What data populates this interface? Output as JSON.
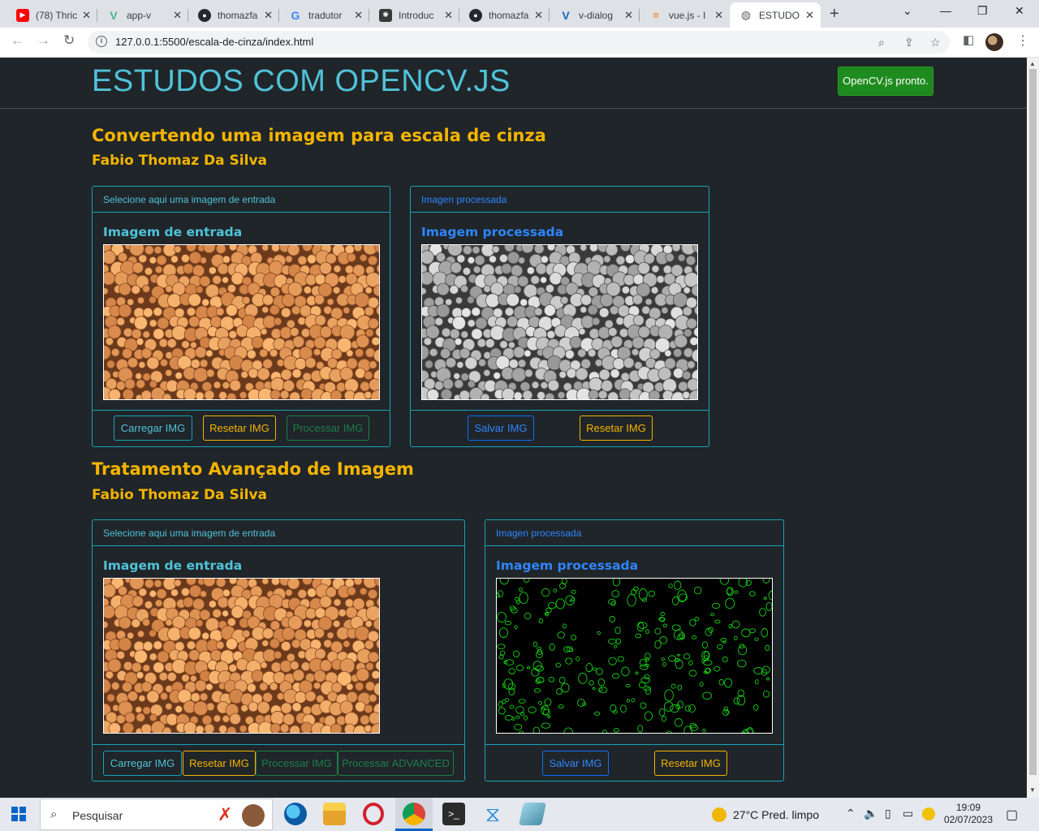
{
  "browser": {
    "tabs": [
      {
        "title": "(78) Thric",
        "favicon": "youtube-icon",
        "color": "#ff0000"
      },
      {
        "title": "app-v",
        "favicon": "vue-icon",
        "color": "#41b883"
      },
      {
        "title": "thomazfa",
        "favicon": "github-icon",
        "color": "#24292f"
      },
      {
        "title": "tradutor",
        "favicon": "google-icon",
        "color": "#4285f4"
      },
      {
        "title": "Introduc",
        "favicon": "openai-icon",
        "color": "#3a3a3a"
      },
      {
        "title": "thomazfa",
        "favicon": "github-icon",
        "color": "#24292f"
      },
      {
        "title": "v-dialog",
        "favicon": "vuetify-icon",
        "color": "#1867c0"
      },
      {
        "title": "vue.js - I",
        "favicon": "stackoverflow-icon",
        "color": "#f48024"
      },
      {
        "title": "ESTUDO",
        "favicon": "globe-icon",
        "color": "#5f6368"
      }
    ],
    "url": "127.0.0.1:5500/escala-de-cinza/index.html"
  },
  "page": {
    "brand": "ESTUDOS COM OPENCV.JS",
    "status": "OpenCV.js pronto.",
    "section1": {
      "title": "Convertendo uma imagem para escala de cinza",
      "author": "Fabio Thomaz Da Silva",
      "input_card": {
        "header": "Selecione aqui uma imagem de entrada",
        "title": "Imagem de entrada",
        "buttons": [
          "Carregar IMG",
          "Resetar IMG",
          "Processar IMG"
        ]
      },
      "output_card": {
        "header": "Imagen processada",
        "title": "Imagem processada",
        "buttons": [
          "Salvar IMG",
          "Resetar IMG"
        ]
      }
    },
    "section2": {
      "title": "Tratamento Avançado de Imagem",
      "author": "Fabio Thomaz Da Silva",
      "input_card": {
        "header": "Selecione aqui uma imagem de entrada",
        "title": "Imagem de entrada",
        "buttons": [
          "Carregar IMG",
          "Resetar IMG",
          "Processar IMG",
          "Processar ADVANCED"
        ]
      },
      "output_card": {
        "header": "Imagen processada",
        "title": "Imagem processada",
        "buttons": [
          "Salvar IMG",
          "Resetar IMG"
        ]
      }
    },
    "colors": {
      "brand": "#4fc3d8",
      "heading": "#f4b400",
      "info": "#17a2b8",
      "success": "#1f8c1f"
    }
  },
  "taskbar": {
    "search_placeholder": "Pesquisar",
    "weather": "27°C  Pred. limpo",
    "time": "19:09",
    "date": "02/07/2023"
  }
}
